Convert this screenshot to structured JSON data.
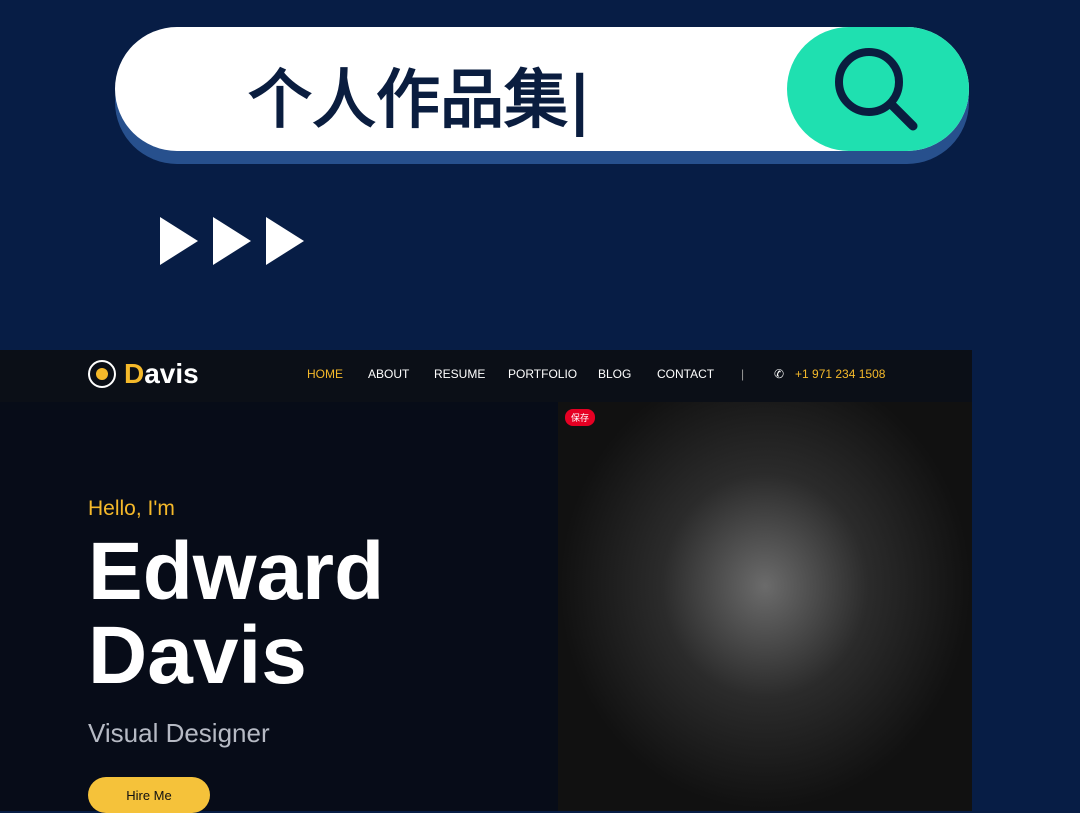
{
  "search": {
    "query": "个人作品集|"
  },
  "site": {
    "logo": {
      "initial": "D",
      "rest": "avis"
    },
    "nav": [
      "HOME",
      "ABOUT",
      "RESUME",
      "PORTFOLIO",
      "BLOG",
      "CONTACT"
    ],
    "separator": "|",
    "phone": "+1 971 234 1508",
    "pin_label": "保存",
    "hello": "Hello, I'm",
    "name_line1": "Edward",
    "name_line2": "Davis",
    "role": "Visual Designer",
    "hire": "Hire Me"
  },
  "colors": {
    "accent": "#f5b92a",
    "search_button": "#1fe0b0",
    "background": "#071d45"
  }
}
